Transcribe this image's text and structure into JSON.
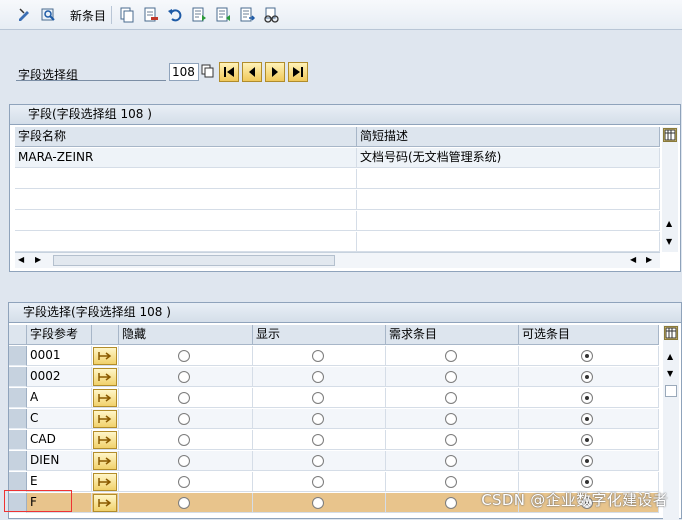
{
  "toolbar": {
    "new_entries_label": "新条目",
    "icons": [
      "display-change-icon",
      "find-icon",
      "copy-icon",
      "delete-icon",
      "undo-icon",
      "prev-entry-icon",
      "next-entry-icon",
      "export-icon",
      "glasses-icon"
    ]
  },
  "field_group": {
    "label": "字段选择组",
    "value": "108"
  },
  "fields_table": {
    "title": "字段(字段选择组 108 )",
    "col_name": "字段名称",
    "col_desc": "简短描述",
    "rows": [
      {
        "name": "MARA-ZEINR",
        "desc": "文档号码(无文档管理系统)"
      }
    ]
  },
  "selection_table": {
    "title": "字段选择(字段选择组 108 )",
    "columns": [
      "字段参考",
      "隐藏",
      "显示",
      "需求条目",
      "可选条目"
    ],
    "rows": [
      {
        "ref": "0001",
        "selected": "可选条目"
      },
      {
        "ref": "0002",
        "selected": "可选条目"
      },
      {
        "ref": "A",
        "selected": "可选条目"
      },
      {
        "ref": "C",
        "selected": "可选条目"
      },
      {
        "ref": "CAD",
        "selected": "可选条目"
      },
      {
        "ref": "DIEN",
        "selected": "可选条目"
      },
      {
        "ref": "E",
        "selected": "可选条目"
      },
      {
        "ref": "F",
        "selected": "可选条目",
        "highlighted": true
      }
    ]
  },
  "watermark": "CSDN @企业数字化建设者",
  "colors": {
    "highlight_row": "#e8c48c",
    "header_bg": "#dde5ee",
    "accent_button": "#f0c85a",
    "selection_box": "#e33333"
  }
}
